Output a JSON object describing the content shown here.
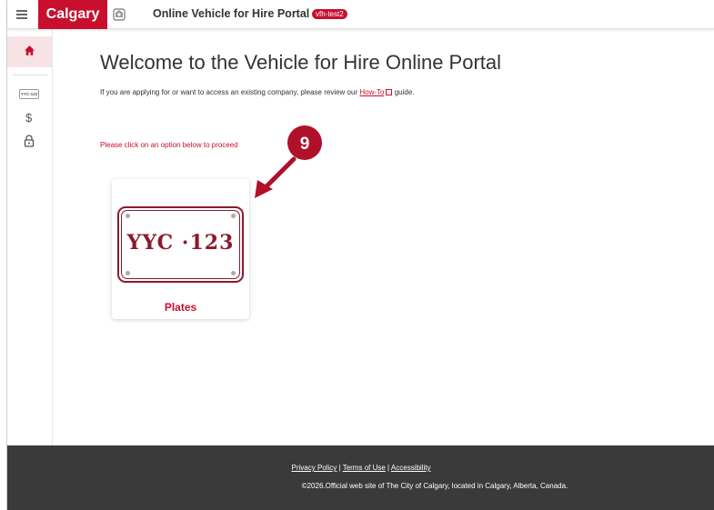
{
  "header": {
    "logo_text": "Calgary",
    "title": "Online Vehicle for Hire Portal",
    "env_badge": "vfh-test2"
  },
  "sidebar": {
    "items": [
      {
        "name": "home",
        "icon": "home-icon"
      },
      {
        "name": "plates",
        "icon": "license-plate-icon",
        "icon_text": "YYC·123"
      },
      {
        "name": "payments",
        "icon": "dollar-icon",
        "icon_text": "$"
      },
      {
        "name": "security",
        "icon": "lock-icon"
      }
    ]
  },
  "main": {
    "title": "Welcome to the Vehicle for Hire Online Portal",
    "intro_before": "If you are applying for or want to access an existing company, please review our ",
    "intro_link": "How-To",
    "intro_after": " guide.",
    "proceed": "Please click on an option below to proceed",
    "cards": [
      {
        "label": "Plates",
        "plate_text": "YYC ·123"
      }
    ]
  },
  "annotation": {
    "step_number": "9",
    "color": "#b0102a"
  },
  "footer": {
    "links": [
      "Privacy Policy",
      "Terms of Use",
      "Accessibility"
    ],
    "separator": "|",
    "copyright": "©2026.Official web site of The City of Calgary, located in Calgary, Alberta, Canada."
  },
  "colors": {
    "brand_red": "#c8102e",
    "plate_maroon": "#8b1a2c",
    "footer_bg": "#3a3a3a",
    "active_nav_bg": "#f7e3e6"
  }
}
